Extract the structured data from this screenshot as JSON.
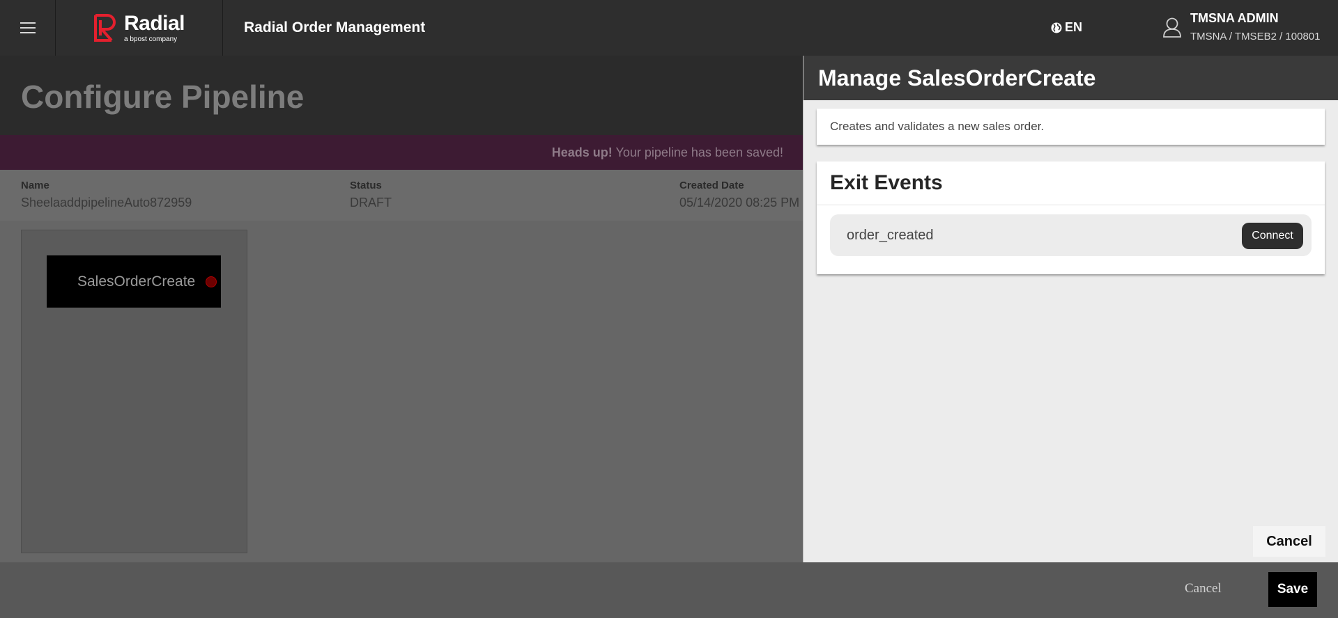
{
  "header": {
    "logo_name": "Radial",
    "logo_tagline": "a bpost company",
    "app_title": "Radial Order Management",
    "language": "EN",
    "user_name": "TMSNA ADMIN",
    "user_context": "TMSNA / TMSEB2 / 100801",
    "brand_color": "#e4202e"
  },
  "page": {
    "title": "Configure Pipeline",
    "alert_strong": "Heads up!",
    "alert_text": " Your pipeline has been saved!",
    "info": {
      "name_label": "Name",
      "name_value": "SheelaaddpipelineAuto872959",
      "status_label": "Status",
      "status_value": "DRAFT",
      "created_label": "Created Date",
      "created_value": "05/14/2020 08:25 PM"
    },
    "node_label": "SalesOrderCreate"
  },
  "footer": {
    "cancel_label": "Cancel",
    "save_label": "Save"
  },
  "panel": {
    "title": "Manage SalesOrderCreate",
    "description": "Creates and validates a new sales order.",
    "exit_events_title": "Exit Events",
    "events": [
      {
        "name": "order_created",
        "action_label": "Connect"
      }
    ],
    "cancel_label": "Cancel"
  }
}
